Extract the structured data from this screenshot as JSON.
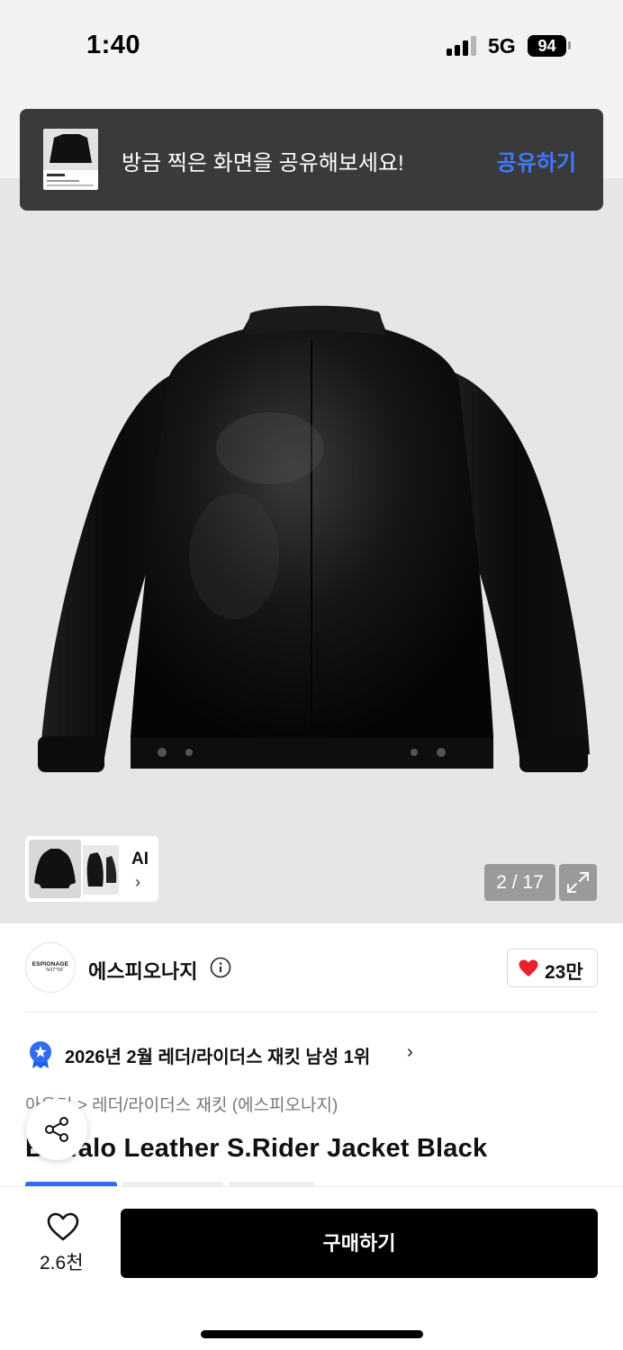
{
  "status_bar": {
    "time": "1:40",
    "network": "5G",
    "battery": "94"
  },
  "toast": {
    "message": "방금 찍은 화면을 공유해보세요!",
    "action_label": "공유하기"
  },
  "gallery": {
    "ai_label": "AI",
    "ai_chevron": "›",
    "pager": "2 / 17"
  },
  "brand": {
    "logo_line1": "ESPIONAGE",
    "logo_line2": "N37°56'",
    "name": "에스피오나지",
    "like_count": "23만"
  },
  "ranking": {
    "text": "2026년 2월 레더/라이더스 재킷 남성 1위",
    "chevron": "›"
  },
  "breadcrumb": "아우터 > 레더/라이더스 재킷 (에스피오나지)",
  "product": {
    "title": "Buffalo Leather S.Rider Jacket Black"
  },
  "bottom_bar": {
    "wish_count": "2.6천",
    "buy_label": "구매하기"
  },
  "colors": {
    "accent_blue": "#3d7bff",
    "heart_red": "#e8202d",
    "button_black": "#000000",
    "toast_bg": "#3a3a3a"
  },
  "icons": [
    "signal-icon",
    "battery-icon",
    "expand-icon",
    "info-icon",
    "heart-icon",
    "rank-badge-icon",
    "share-icon",
    "wish-heart-icon"
  ]
}
